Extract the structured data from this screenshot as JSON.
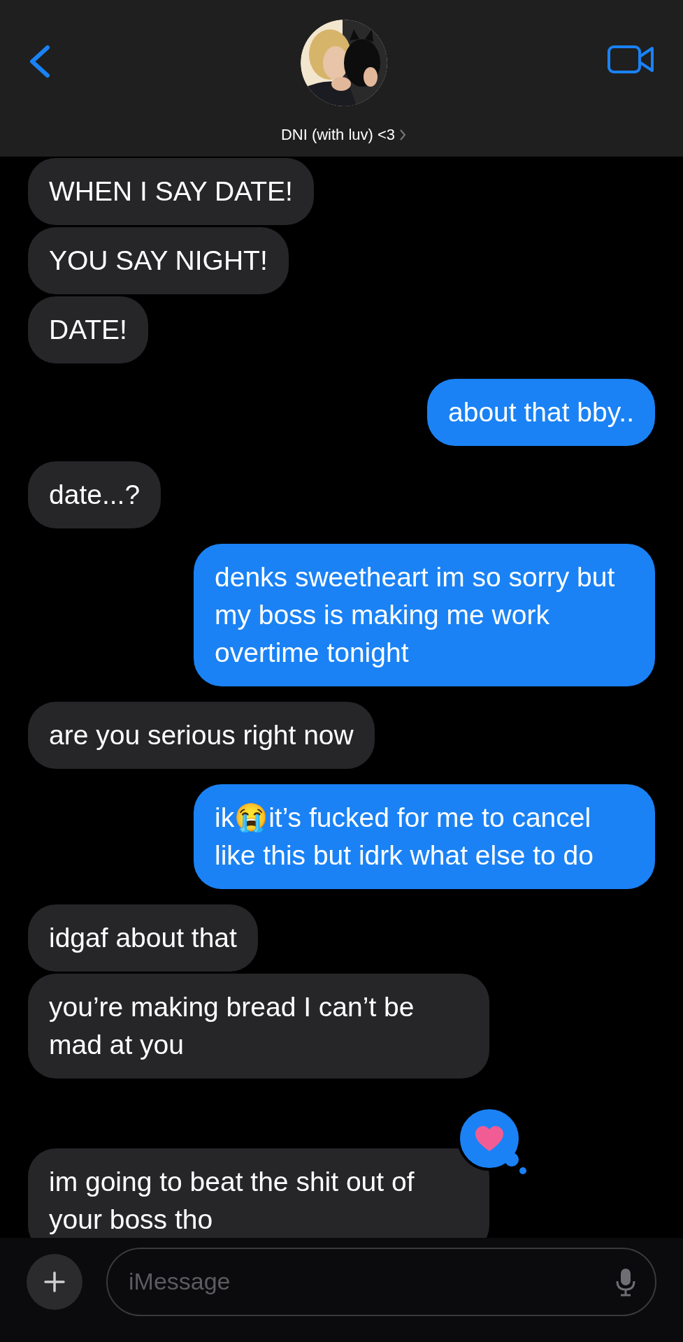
{
  "header": {
    "contact_name": "DNI (with luv) <3"
  },
  "messages": [
    {
      "kind": "received",
      "text": "WHEN I SAY DATE!"
    },
    {
      "kind": "received",
      "text": "YOU SAY NIGHT!"
    },
    {
      "kind": "received",
      "text": "DATE!"
    },
    {
      "kind": "sent",
      "text": "about that bby.."
    },
    {
      "kind": "received",
      "text": "date...?"
    },
    {
      "kind": "sent",
      "text": "denks sweetheart im so sorry but my boss is making me work overtime tonight"
    },
    {
      "kind": "received",
      "text": "are you serious right now"
    },
    {
      "kind": "sent",
      "text": "ik😭it’s fucked for me to cancel like this but idrk what else to do"
    },
    {
      "kind": "received",
      "text": "idgaf about that"
    },
    {
      "kind": "received",
      "text": "you’re making bread I can’t be mad at you"
    },
    {
      "kind": "received",
      "text": "im going to beat the shit out of your boss tho",
      "reaction": {
        "kind": "heart"
      }
    }
  ],
  "composer": {
    "placeholder": "iMessage"
  }
}
